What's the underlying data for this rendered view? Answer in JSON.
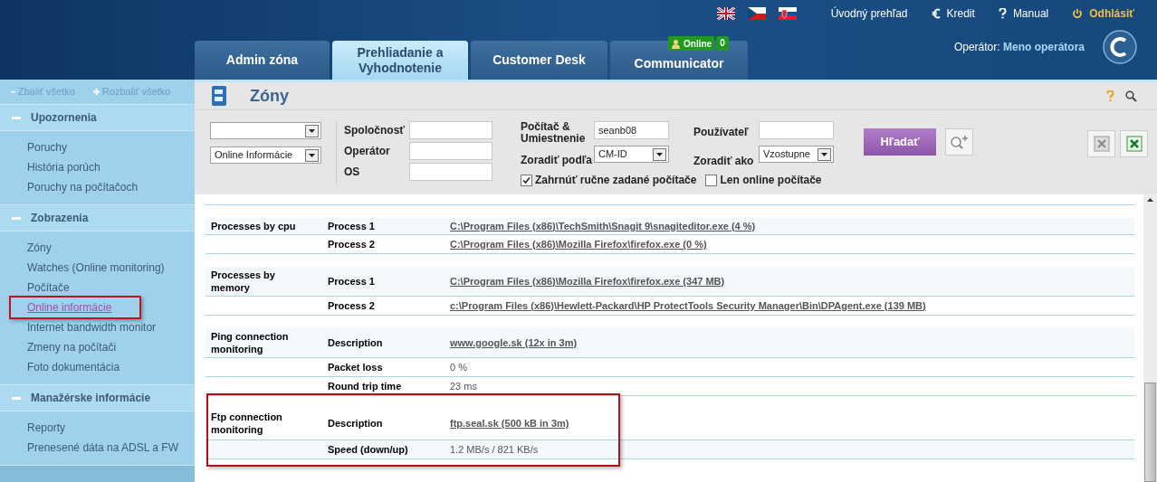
{
  "top_links": [
    {
      "kind": "home",
      "label": "Úvodný prehľad"
    },
    {
      "kind": "credit",
      "label": "Kredit"
    },
    {
      "kind": "help",
      "label": "Manual"
    },
    {
      "kind": "logout",
      "label": "Odhlásiť"
    }
  ],
  "flags": [
    {
      "kind": "uk"
    },
    {
      "kind": "cz"
    },
    {
      "kind": "sk"
    }
  ],
  "tabs": [
    {
      "label": "Admin zóna",
      "selected": false
    },
    {
      "label": "Prehliadanie a Vyhodnotenie",
      "selected": true
    },
    {
      "label": "Customer Desk",
      "selected": false
    },
    {
      "label": "Communicator",
      "selected": false,
      "status": "Online",
      "count": "0"
    }
  ],
  "operator": {
    "label": "Operátor:",
    "name": "Meno operátora"
  },
  "sidebar": {
    "collapse_all": "Zbaliť všetko",
    "expand_all": "Rozbaliť všetko",
    "sections": [
      {
        "title": "Upozornenia",
        "expanded": true,
        "items": [
          {
            "label": "Poruchy",
            "selected": false
          },
          {
            "label": "História porúch",
            "selected": false
          },
          {
            "label": "Poruchy na počítačoch",
            "selected": false
          }
        ]
      },
      {
        "title": "Zobrazenia",
        "expanded": true,
        "items": [
          {
            "label": "Zóny",
            "selected": false
          },
          {
            "label": "Watches (Online monitoring)",
            "selected": false
          },
          {
            "label": "Počítače",
            "selected": false
          },
          {
            "label": "Online informácie",
            "selected": true
          },
          {
            "label": "Internet bandwidth monitor",
            "selected": false
          },
          {
            "label": "Zmeny na počítači",
            "selected": false
          },
          {
            "label": "Foto dokumentácia",
            "selected": false
          }
        ]
      },
      {
        "title": "Manažérske informácie",
        "expanded": true,
        "items": [
          {
            "label": "Reporty",
            "selected": false
          },
          {
            "label": "Prenesené dáta na ADSL a FW",
            "selected": false
          }
        ]
      }
    ]
  },
  "page_title": "Zóny",
  "filter": {
    "select_2": "Online Informácie",
    "company": {
      "label": "Spoločnosť"
    },
    "operator": {
      "label": "Operátor"
    },
    "os": {
      "label": "OS"
    },
    "computer": {
      "label": "Počítač & Umiestnenie",
      "value": "seanb08"
    },
    "sort_by": {
      "label": "Zoradiť podľa",
      "value": "CM-ID"
    },
    "user": {
      "label": "Používateľ"
    },
    "sort_order": {
      "label": "Zoradiť ako",
      "value": "Vzostupne"
    },
    "checkboxes": [
      {
        "label": "Zahrnúť ručne zadané počítače",
        "checked": true
      },
      {
        "label": "Len online počítače",
        "checked": false
      }
    ],
    "search_button": "Hľadať"
  },
  "sections": [
    {
      "label": "Processes by cpu",
      "highlighted": false,
      "rows": [
        {
          "name": "Process 1",
          "kind": "link",
          "value": "C:\\Program Files (x86)\\TechSmith\\Snagit 9\\snagiteditor.exe (4 %)"
        },
        {
          "name": "Process 2",
          "kind": "link",
          "value": "C:\\Program Files (x86)\\Mozilla Firefox\\firefox.exe (0 %)"
        }
      ]
    },
    {
      "label": "Processes by memory",
      "highlighted": false,
      "rows": [
        {
          "name": "Process 1",
          "kind": "link",
          "value": "C:\\Program Files (x86)\\Mozilla Firefox\\firefox.exe (347 MB)"
        },
        {
          "name": "Process 2",
          "kind": "link",
          "value": "c:\\Program Files (x86)\\Hewlett-Packard\\HP ProtectTools Security Manager\\Bin\\DPAgent.exe (139 MB)"
        }
      ]
    },
    {
      "label": "Ping connection monitoring",
      "highlighted": false,
      "rows": [
        {
          "name": "Description",
          "kind": "link",
          "value": "www.google.sk (12x in 3m)"
        },
        {
          "name": "Packet loss",
          "kind": "text",
          "value": "0 %"
        },
        {
          "name": "Round trip time",
          "kind": "text",
          "value": "23 ms"
        }
      ]
    },
    {
      "label": "Ftp connection monitoring",
      "highlighted": true,
      "rows": [
        {
          "name": "Description",
          "kind": "link",
          "value": "ftp.seal.sk (500 kB in 3m)"
        },
        {
          "name": "Speed (down/up)",
          "kind": "text",
          "value": "1.2 MB/s / 821 KB/s"
        }
      ]
    }
  ]
}
